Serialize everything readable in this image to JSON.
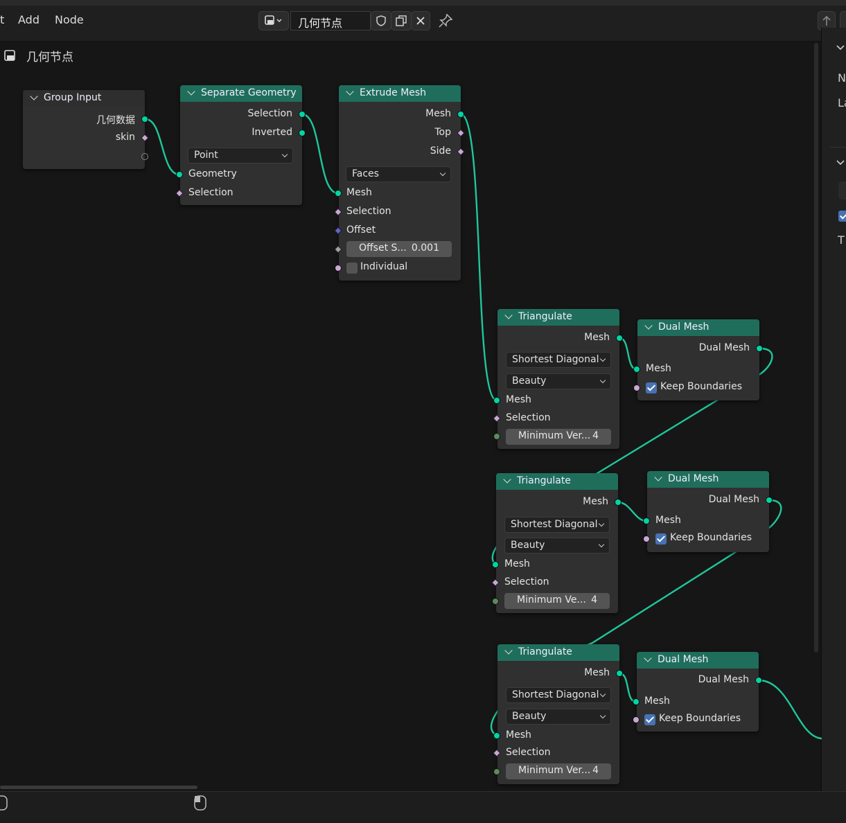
{
  "menu": {
    "partial": "t",
    "add": "Add",
    "node": "Node"
  },
  "header": {
    "tree_name": "几何节点"
  },
  "breadcrumb": {
    "label": "几何节点"
  },
  "sidebar": {
    "labels": [
      "N",
      "La",
      "T"
    ]
  },
  "nodes": {
    "group_input": {
      "title": "Group Input",
      "out1": "几何数据",
      "out2": "skin"
    },
    "separate": {
      "title": "Separate Geometry",
      "out1": "Selection",
      "out2": "Inverted",
      "domain": "Point",
      "in1": "Geometry",
      "in2": "Selection"
    },
    "extrude": {
      "title": "Extrude Mesh",
      "out1": "Mesh",
      "out2": "Top",
      "out3": "Side",
      "mode": "Faces",
      "in1": "Mesh",
      "in2": "Selection",
      "in3": "Offset",
      "scale_label": "Offset S...",
      "scale_value": "0.001",
      "individual": "Individual"
    },
    "tri1": {
      "title": "Triangulate",
      "out": "Mesh",
      "quad": "Shortest Diagonal",
      "ngon": "Beauty",
      "in1": "Mesh",
      "in2": "Selection",
      "minv_label": "Minimum Ver...",
      "minv_value": "4"
    },
    "tri2": {
      "title": "Triangulate",
      "out": "Mesh",
      "quad": "Shortest Diagonal",
      "ngon": "Beauty",
      "in1": "Mesh",
      "in2": "Selection",
      "minv_label": "Minimum Ve...",
      "minv_value": "4"
    },
    "tri3": {
      "title": "Triangulate",
      "out": "Mesh",
      "quad": "Shortest Diagonal",
      "ngon": "Beauty",
      "in1": "Mesh",
      "in2": "Selection",
      "minv_label": "Minimum Ver...",
      "minv_value": "4"
    },
    "dual1": {
      "title": "Dual Mesh",
      "out": "Dual Mesh",
      "in1": "Mesh",
      "keep": "Keep Boundaries"
    },
    "dual2": {
      "title": "Dual Mesh",
      "out": "Dual Mesh",
      "in1": "Mesh",
      "keep": "Keep Boundaries"
    },
    "dual3": {
      "title": "Dual Mesh",
      "out": "Dual Mesh",
      "in1": "Mesh",
      "keep": "Keep Boundaries"
    }
  },
  "colors": {
    "header_geometry": "#1f6e5b",
    "socket_geometry": "#00d6a3",
    "wire": "#1fc79a"
  }
}
